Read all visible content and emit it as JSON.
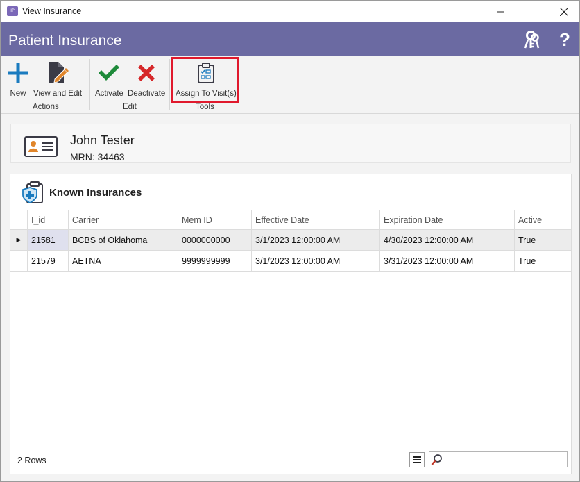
{
  "window": {
    "title": "View Insurance",
    "app_icon_text": "IP"
  },
  "header": {
    "title": "Patient Insurance",
    "help_label": "?"
  },
  "ribbon": {
    "groups": [
      {
        "label": "Actions",
        "buttons": [
          {
            "label": "New",
            "icon": "plus-icon"
          },
          {
            "label": "View and Edit",
            "icon": "document-edit-icon"
          }
        ]
      },
      {
        "label": "Edit",
        "buttons": [
          {
            "label": "Activate",
            "icon": "checkmark-icon"
          },
          {
            "label": "Deactivate",
            "icon": "x-icon"
          }
        ]
      },
      {
        "label": "Tools",
        "buttons": [
          {
            "label": "Assign To Visit(s)",
            "icon": "clipboard-checklist-icon"
          }
        ]
      }
    ]
  },
  "patient": {
    "name": "John Tester",
    "mrn": "MRN: 34463"
  },
  "insurances": {
    "title": "Known Insurances",
    "columns": [
      "I_id",
      "Carrier",
      "Mem ID",
      "Effective Date",
      "Expiration Date",
      "Active"
    ],
    "rows": [
      {
        "id": "21581",
        "carrier": "BCBS of Oklahoma",
        "mem_id": "0000000000",
        "effective": "3/1/2023 12:00:00 AM",
        "expiration": "4/30/2023 12:00:00 AM",
        "active": "True",
        "selected": true
      },
      {
        "id": "21579",
        "carrier": "AETNA",
        "mem_id": "9999999999",
        "effective": "3/1/2023 12:00:00 AM",
        "expiration": "3/31/2023 12:00:00 AM",
        "active": "True",
        "selected": false
      }
    ],
    "row_count": "2 Rows"
  },
  "search": {
    "value": "",
    "placeholder": ""
  },
  "colors": {
    "header_bg": "#6b6aa2",
    "accent_green": "#1e8a3a",
    "accent_red": "#d6282a",
    "accent_blue": "#1a7bbf",
    "highlight_border": "#e0192d"
  }
}
